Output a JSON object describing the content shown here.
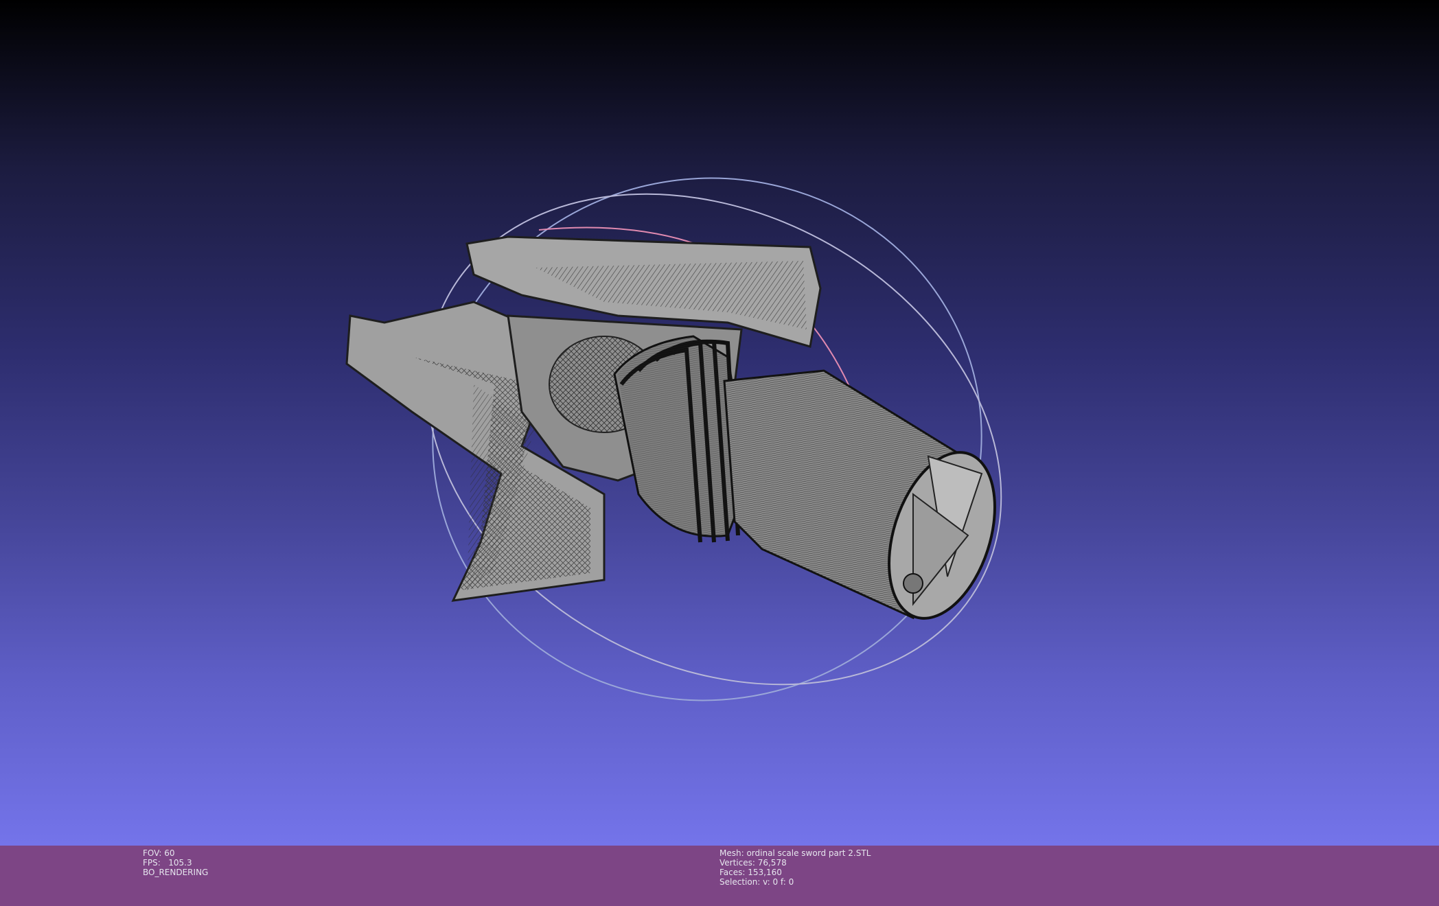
{
  "viewer": {
    "background_top": "#000000",
    "background_bottom": "#7474ea",
    "mesh_color": "#9a9a9a",
    "wire_color": "#2a2a2a",
    "trackball_colors": [
      "#e08ab0",
      "#8a9ad0",
      "#b8b8d8"
    ]
  },
  "status_bar": {
    "color": "#7d4585",
    "left": {
      "fov": "FOV: 60",
      "fps": "FPS:   105.3",
      "mode": "BO_RENDERING"
    },
    "center": {
      "mesh": "Mesh: ordinal scale sword part 2.STL",
      "vertices": "Vertices: 76,578",
      "faces": "Faces: 153,160",
      "selection": "Selection: v: 0 f: 0"
    }
  }
}
